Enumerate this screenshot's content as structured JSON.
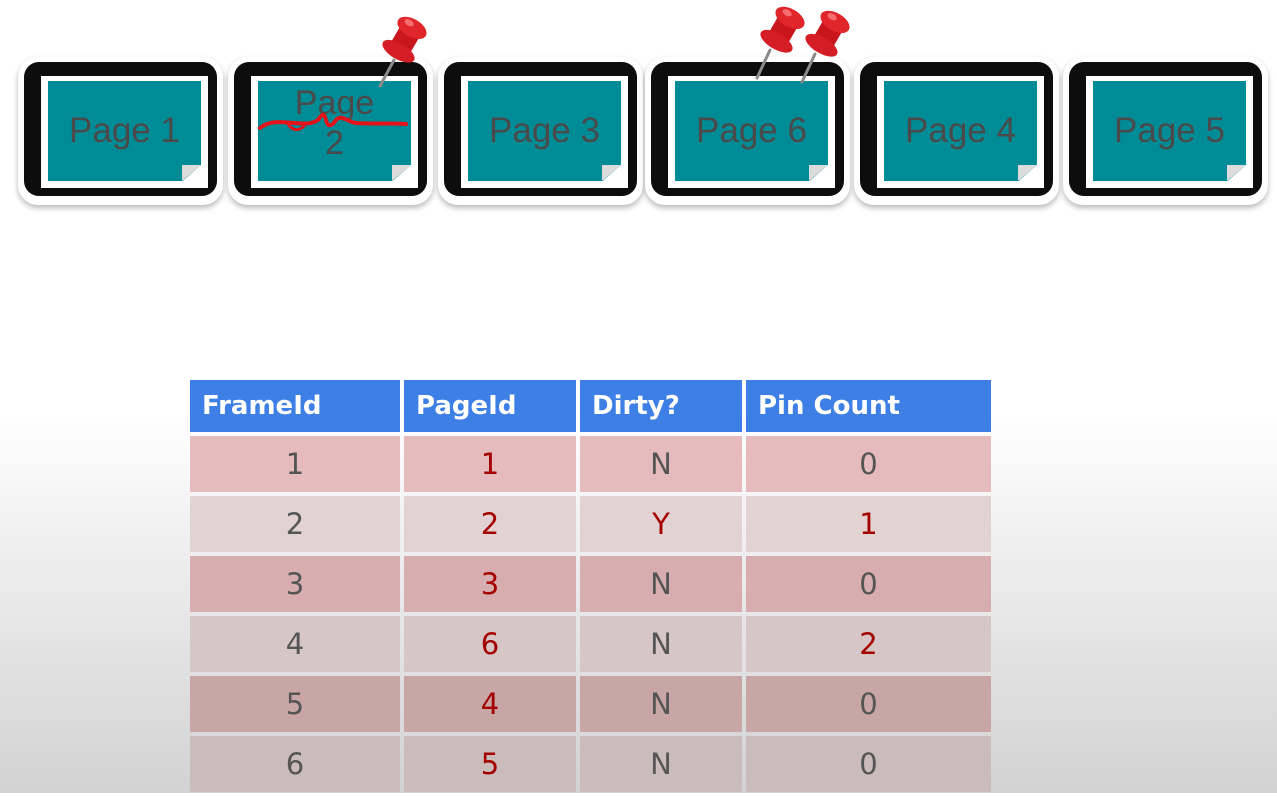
{
  "frames": [
    {
      "label": "Page 1",
      "pins": 0,
      "dirty": false
    },
    {
      "label": "Page 2",
      "label_line1": "Page",
      "label_line2": "2",
      "pins": 1,
      "dirty": true
    },
    {
      "label": "Page 3",
      "pins": 0,
      "dirty": false
    },
    {
      "label": "Page 6",
      "pins": 2,
      "dirty": false
    },
    {
      "label": "Page 4",
      "pins": 0,
      "dirty": false
    },
    {
      "label": "Page 5",
      "pins": 0,
      "dirty": false
    }
  ],
  "table": {
    "headers": [
      "FrameId",
      "PageId",
      "Dirty?",
      "Pin Count"
    ],
    "rows": [
      {
        "frame_id": "1",
        "page_id": "1",
        "dirty": "N",
        "pin_count": "0"
      },
      {
        "frame_id": "2",
        "page_id": "2",
        "dirty": "Y",
        "pin_count": "1"
      },
      {
        "frame_id": "3",
        "page_id": "3",
        "dirty": "N",
        "pin_count": "0"
      },
      {
        "frame_id": "4",
        "page_id": "6",
        "dirty": "N",
        "pin_count": "2"
      },
      {
        "frame_id": "5",
        "page_id": "4",
        "dirty": "N",
        "pin_count": "0"
      },
      {
        "frame_id": "6",
        "page_id": "5",
        "dirty": "N",
        "pin_count": "0"
      }
    ]
  },
  "colors": {
    "page_fill": "#008c96",
    "header_fill": "#3e7fe6",
    "highlight_text": "#a40000",
    "pin": "#e02020"
  },
  "icons": [
    "push-pin-icon",
    "red-scribble-mark"
  ]
}
